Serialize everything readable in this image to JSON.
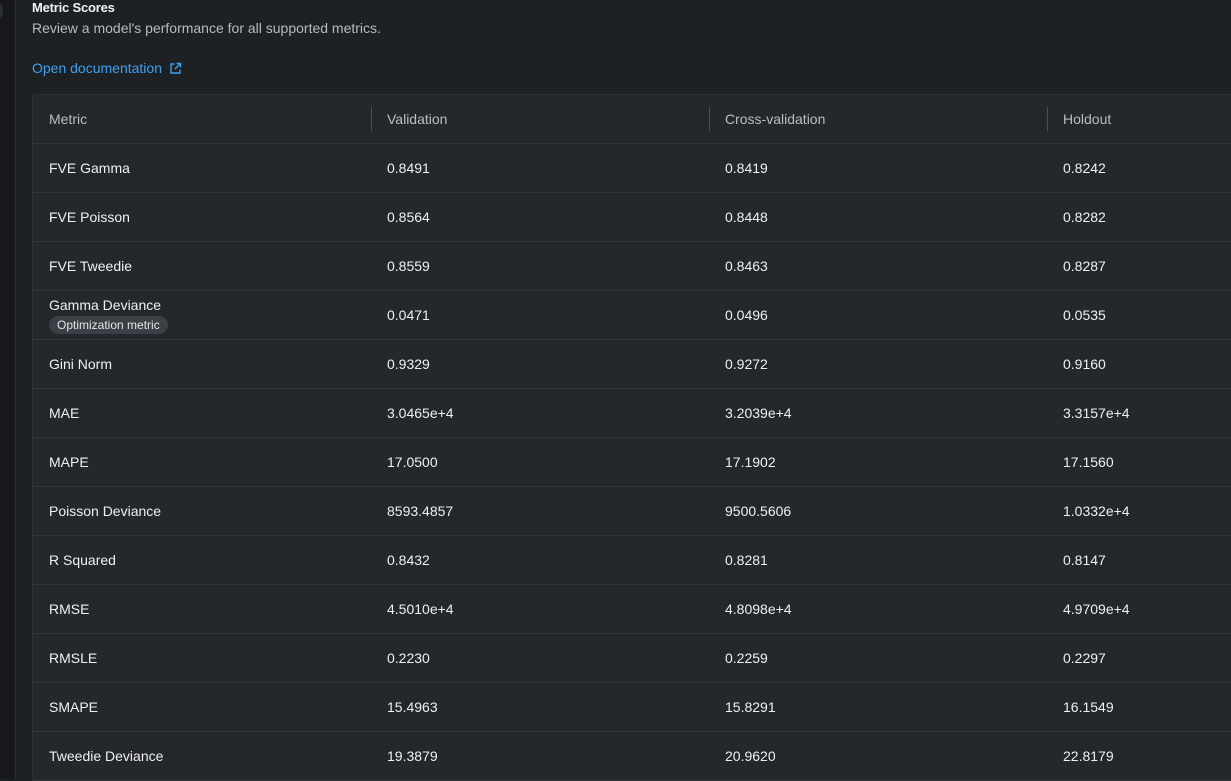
{
  "header": {
    "title": "Metric Scores",
    "subtitle": "Review a model's performance for all supported metrics.",
    "doc_link": "Open documentation",
    "doc_link_icon": "external-link-icon",
    "link_color": "#3aa0f0"
  },
  "table": {
    "columns": [
      "Metric",
      "Validation",
      "Cross-validation",
      "Holdout"
    ],
    "rows": [
      {
        "metric": "FVE Gamma",
        "validation": "0.8491",
        "cross_validation": "0.8419",
        "holdout": "0.8242"
      },
      {
        "metric": "FVE Poisson",
        "validation": "0.8564",
        "cross_validation": "0.8448",
        "holdout": "0.8282"
      },
      {
        "metric": "FVE Tweedie",
        "validation": "0.8559",
        "cross_validation": "0.8463",
        "holdout": "0.8287"
      },
      {
        "metric": "Gamma Deviance",
        "badge": "Optimization metric",
        "validation": "0.0471",
        "cross_validation": "0.0496",
        "holdout": "0.0535"
      },
      {
        "metric": "Gini Norm",
        "validation": "0.9329",
        "cross_validation": "0.9272",
        "holdout": "0.9160"
      },
      {
        "metric": "MAE",
        "validation": "3.0465e+4",
        "cross_validation": "3.2039e+4",
        "holdout": "3.3157e+4"
      },
      {
        "metric": "MAPE",
        "validation": "17.0500",
        "cross_validation": "17.1902",
        "holdout": "17.1560"
      },
      {
        "metric": "Poisson Deviance",
        "validation": "8593.4857",
        "cross_validation": "9500.5606",
        "holdout": "1.0332e+4"
      },
      {
        "metric": "R Squared",
        "validation": "0.8432",
        "cross_validation": "0.8281",
        "holdout": "0.8147"
      },
      {
        "metric": "RMSE",
        "validation": "4.5010e+4",
        "cross_validation": "4.8098e+4",
        "holdout": "4.9709e+4"
      },
      {
        "metric": "RMSLE",
        "validation": "0.2230",
        "cross_validation": "0.2259",
        "holdout": "0.2297"
      },
      {
        "metric": "SMAPE",
        "validation": "15.4963",
        "cross_validation": "15.8291",
        "holdout": "16.1549"
      },
      {
        "metric": "Tweedie Deviance",
        "validation": "19.3879",
        "cross_validation": "20.9620",
        "holdout": "22.8179"
      }
    ]
  }
}
